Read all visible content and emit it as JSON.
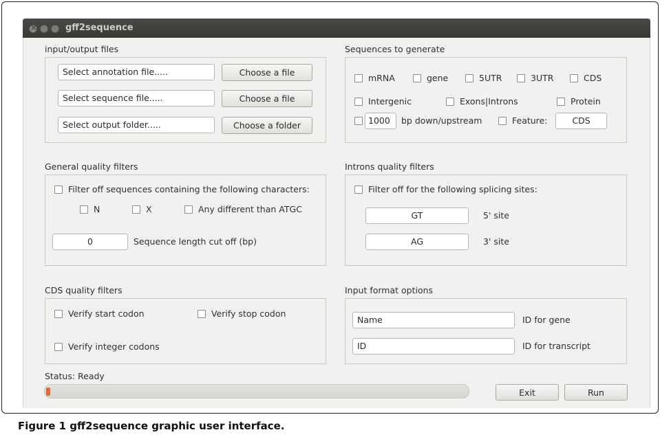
{
  "window": {
    "title": "gff2sequence"
  },
  "io": {
    "title": "input/output files",
    "annotation_value": "Select annotation file.....",
    "sequence_value": "Select sequence file.....",
    "output_value": "Select output folder.....",
    "choose_file_label": "Choose a file",
    "choose_file_label2": "Choose a file",
    "choose_folder_label": "Choose a folder"
  },
  "seqgen": {
    "title": "Sequences to generate",
    "mrna": "mRNA",
    "gene": "gene",
    "utr5": "5UTR",
    "utr3": "3UTR",
    "cds": "CDS",
    "intergenic": "Intergenic",
    "exons_introns": "Exons|Introns",
    "protein": "Protein",
    "bp_value": "1000",
    "bp_label": "bp down/upstream",
    "feature_label": "Feature:",
    "feature_value": "CDS"
  },
  "general": {
    "title": "General quality filters",
    "filter_label": "Filter off sequences containing the following characters:",
    "n": "N",
    "x": "X",
    "any": "Any different than ATGC",
    "length_value": "0",
    "length_label": "Sequence length cut off (bp)"
  },
  "introns": {
    "title": "Introns quality filters",
    "filter_label": "Filter off for the following splicing sites:",
    "site5_value": "GT",
    "site5_label": "5' site",
    "site3_value": "AG",
    "site3_label": "3' site"
  },
  "cds": {
    "title": "CDS quality filters",
    "start": "Verify start codon",
    "stop": "Verify stop codon",
    "integer": "Verify integer codons"
  },
  "format": {
    "title": "Input format options",
    "gene_value": "Name",
    "gene_label": "ID for gene",
    "transcript_value": "ID",
    "transcript_label": "ID for transcript"
  },
  "status": {
    "text": "Status: Ready",
    "progress": 0.01,
    "progress_color": "#e06b33"
  },
  "actions": {
    "exit": "Exit",
    "run": "Run"
  },
  "caption": {
    "bold": "Figure 1 gff2sequence graphic user interface."
  }
}
